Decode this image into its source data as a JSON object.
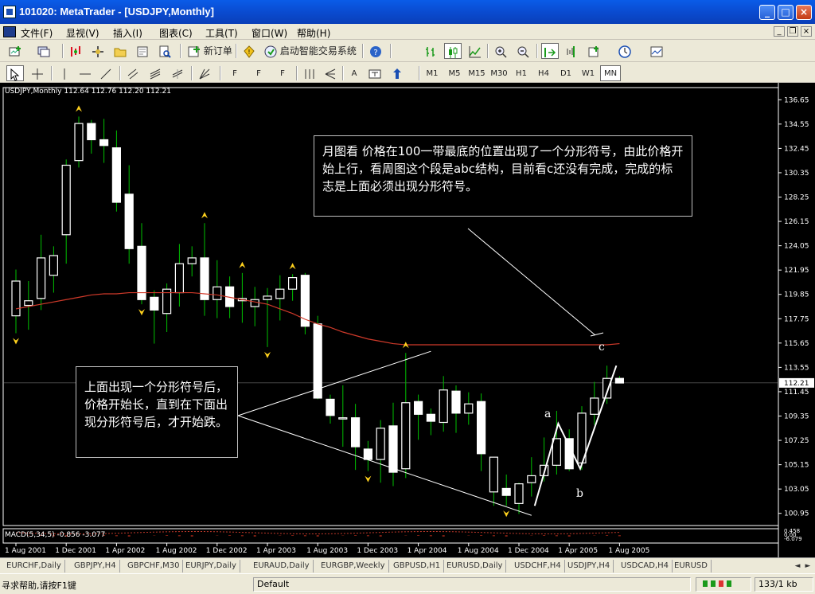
{
  "window": {
    "title": "101020: MetaTrader - [USDJPY,Monthly]",
    "minimize_label": "_",
    "maximize_label": "□",
    "close_label": "×"
  },
  "menu": {
    "items": [
      "文件(F)",
      "显视(V)",
      "插入(I)",
      "图表(C)",
      "工具(T)",
      "窗口(W)",
      "帮助(H)"
    ],
    "mdi_minimize": "_",
    "mdi_restore": "❐",
    "mdi_close": "×"
  },
  "toolbar": {
    "new_order_label": "新订单",
    "expert_label": "启动智能交易系统",
    "timeframes": [
      "M1",
      "M5",
      "M15",
      "M30",
      "H1",
      "H4",
      "D1",
      "W1",
      "MN"
    ],
    "active_timeframe": "MN",
    "text_tool_label": "A",
    "draw_tool_labels": [
      "F",
      "F",
      "F"
    ]
  },
  "chart": {
    "symbol_info": "USDJPY,Monthly  112.64 112.76 112.20 112.21",
    "macd_info": "MACD(5,34,5) -0.856 -3.077",
    "current_price": "112.21",
    "price_ticks": [
      "136.65",
      "134.55",
      "132.45",
      "130.35",
      "128.25",
      "126.15",
      "124.05",
      "121.95",
      "119.85",
      "117.75",
      "115.65",
      "113.55",
      "111.45",
      "109.35",
      "107.25",
      "105.15",
      "103.05",
      "100.95"
    ],
    "time_ticks": [
      "1 Aug 2001",
      "1 Dec 2001",
      "1 Apr 2002",
      "1 Aug 2002",
      "1 Dec 2002",
      "1 Apr 2003",
      "1 Aug 2003",
      "1 Dec 2003",
      "1 Apr 2004",
      "1 Aug 2004",
      "1 Dec 2004",
      "1 Apr 2005",
      "1 Aug 2005"
    ],
    "macd_ticks": [
      "0.458",
      "0.00",
      "-6.079"
    ],
    "colors": {
      "bull": "#ffffff",
      "bear": "#ffffff",
      "wick": "#00c000",
      "ma": "#d03a2a",
      "fractal": "#ffd21e",
      "background": "#000000",
      "grid_text": "#ffffff"
    },
    "annotation_top": "月图看 价格在100一带最底的位置出现了一个分形符号，由此价格开始上行，看周图这个段是abc结构，目前看c还没有完成，完成的标志是上面必须出现分形符号。",
    "annotation_left": "上面出现一个分形符号后，价格开始长，直到在下面出现分形符号后，才开始跌。",
    "wave_a": "a",
    "wave_b": "b",
    "wave_c": "c"
  },
  "symbol_tabs": [
    "EURCHF,Daily",
    "GBPJPY,H4",
    "GBPCHF,M30",
    "EURJPY,Daily",
    "EURAUD,Daily",
    "EURGBP,Weekly",
    "GBPUSD,H1",
    "EURUSD,Daily",
    "USDCHF,H4",
    "USDJPY,H4",
    "USDCAD,H4",
    "EURUSD"
  ],
  "status": {
    "help_text": "寻求帮助,请按F1键",
    "profile": "Default",
    "traffic": "133/1 kb"
  },
  "chart_data": {
    "type": "candlestick",
    "symbol": "USDJPY",
    "timeframe": "Monthly",
    "ylim": [
      99.9,
      137.7
    ],
    "candles": [
      {
        "o": 118.0,
        "h": 122.0,
        "l": 116.5,
        "c": 121.0
      },
      {
        "o": 118.9,
        "h": 121.0,
        "l": 116.8,
        "c": 119.3
      },
      {
        "o": 119.5,
        "h": 125.0,
        "l": 118.5,
        "c": 123.0
      },
      {
        "o": 121.5,
        "h": 124.0,
        "l": 120.0,
        "c": 123.2
      },
      {
        "o": 125.0,
        "h": 131.5,
        "l": 122.5,
        "c": 131.0
      },
      {
        "o": 131.4,
        "h": 135.2,
        "l": 130.8,
        "c": 134.6
      },
      {
        "o": 134.6,
        "h": 134.9,
        "l": 132.0,
        "c": 133.2
      },
      {
        "o": 133.2,
        "h": 135.0,
        "l": 131.2,
        "c": 132.7
      },
      {
        "o": 132.5,
        "h": 134.0,
        "l": 127.0,
        "c": 127.8
      },
      {
        "o": 128.5,
        "h": 131.0,
        "l": 122.5,
        "c": 123.8
      },
      {
        "o": 124.0,
        "h": 126.0,
        "l": 119.0,
        "c": 119.4
      },
      {
        "o": 119.6,
        "h": 120.2,
        "l": 115.6,
        "c": 118.5
      },
      {
        "o": 118.2,
        "h": 120.8,
        "l": 116.6,
        "c": 120.3
      },
      {
        "o": 120.0,
        "h": 124.2,
        "l": 118.8,
        "c": 122.5
      },
      {
        "o": 122.5,
        "h": 124.0,
        "l": 121.4,
        "c": 123.0
      },
      {
        "o": 123.0,
        "h": 126.0,
        "l": 118.0,
        "c": 119.4
      },
      {
        "o": 119.4,
        "h": 122.8,
        "l": 117.8,
        "c": 120.5
      },
      {
        "o": 120.5,
        "h": 121.4,
        "l": 117.8,
        "c": 118.8
      },
      {
        "o": 119.3,
        "h": 121.7,
        "l": 117.4,
        "c": 119.5
      },
      {
        "o": 118.8,
        "h": 120.5,
        "l": 117.1,
        "c": 119.4
      },
      {
        "o": 119.4,
        "h": 120.4,
        "l": 115.3,
        "c": 119.7
      },
      {
        "o": 119.5,
        "h": 121.5,
        "l": 117.6,
        "c": 120.3
      },
      {
        "o": 120.3,
        "h": 121.6,
        "l": 119.3,
        "c": 121.3
      },
      {
        "o": 121.5,
        "h": 121.7,
        "l": 116.4,
        "c": 117.1
      },
      {
        "o": 117.3,
        "h": 118.0,
        "l": 110.8,
        "c": 110.9
      },
      {
        "o": 110.8,
        "h": 111.2,
        "l": 108.7,
        "c": 109.4
      },
      {
        "o": 109.1,
        "h": 112.0,
        "l": 106.7,
        "c": 109.2
      },
      {
        "o": 109.2,
        "h": 110.4,
        "l": 104.7,
        "c": 106.7
      },
      {
        "o": 106.5,
        "h": 107.2,
        "l": 104.6,
        "c": 105.6
      },
      {
        "o": 105.6,
        "h": 109.0,
        "l": 103.6,
        "c": 108.3
      },
      {
        "o": 108.5,
        "h": 110.5,
        "l": 103.3,
        "c": 104.5
      },
      {
        "o": 104.8,
        "h": 114.8,
        "l": 104.0,
        "c": 110.5
      },
      {
        "o": 110.6,
        "h": 111.2,
        "l": 107.3,
        "c": 109.5
      },
      {
        "o": 109.5,
        "h": 110.0,
        "l": 107.7,
        "c": 108.9
      },
      {
        "o": 108.8,
        "h": 112.8,
        "l": 108.0,
        "c": 111.6
      },
      {
        "o": 111.5,
        "h": 112.0,
        "l": 107.9,
        "c": 109.6
      },
      {
        "o": 109.6,
        "h": 111.4,
        "l": 108.6,
        "c": 110.4
      },
      {
        "o": 110.6,
        "h": 111.3,
        "l": 104.6,
        "c": 106.1
      },
      {
        "o": 102.8,
        "h": 105.4,
        "l": 101.6,
        "c": 105.8
      },
      {
        "o": 103.1,
        "h": 104.3,
        "l": 101.6,
        "c": 102.5
      },
      {
        "o": 101.8,
        "h": 103.6,
        "l": 100.9,
        "c": 103.5
      },
      {
        "o": 103.6,
        "h": 105.8,
        "l": 102.4,
        "c": 104.2
      },
      {
        "o": 104.2,
        "h": 107.5,
        "l": 103.7,
        "c": 105.1
      },
      {
        "o": 105.1,
        "h": 109.8,
        "l": 104.3,
        "c": 107.4
      },
      {
        "o": 107.4,
        "h": 108.2,
        "l": 104.6,
        "c": 104.8
      },
      {
        "o": 105.3,
        "h": 110.2,
        "l": 104.7,
        "c": 109.6
      },
      {
        "o": 109.5,
        "h": 112.3,
        "l": 108.6,
        "c": 110.9
      },
      {
        "o": 110.9,
        "h": 113.7,
        "l": 110.4,
        "c": 112.6
      },
      {
        "o": 112.6,
        "h": 112.8,
        "l": 112.2,
        "c": 112.2
      }
    ],
    "moving_average": [
      118.6,
      118.8,
      119.0,
      119.2,
      119.4,
      119.6,
      119.8,
      119.9,
      119.9,
      120.0,
      120.0,
      120.0,
      120.0,
      120.0,
      120.0,
      119.9,
      119.8,
      119.6,
      119.4,
      119.2,
      119.0,
      118.6,
      118.2,
      117.7,
      117.3,
      117.0,
      116.6,
      116.3,
      116.0,
      115.8,
      115.6,
      115.5,
      115.5,
      115.5,
      115.5,
      115.5,
      115.5,
      115.5,
      115.5,
      115.5,
      115.5,
      115.5,
      115.5,
      115.5,
      115.5,
      115.5,
      115.5,
      115.5,
      115.6
    ],
    "fractals_up": [
      5,
      15,
      18,
      22,
      31
    ],
    "fractals_down": [
      0,
      10,
      20,
      28,
      39
    ],
    "current_price": 112.21
  }
}
